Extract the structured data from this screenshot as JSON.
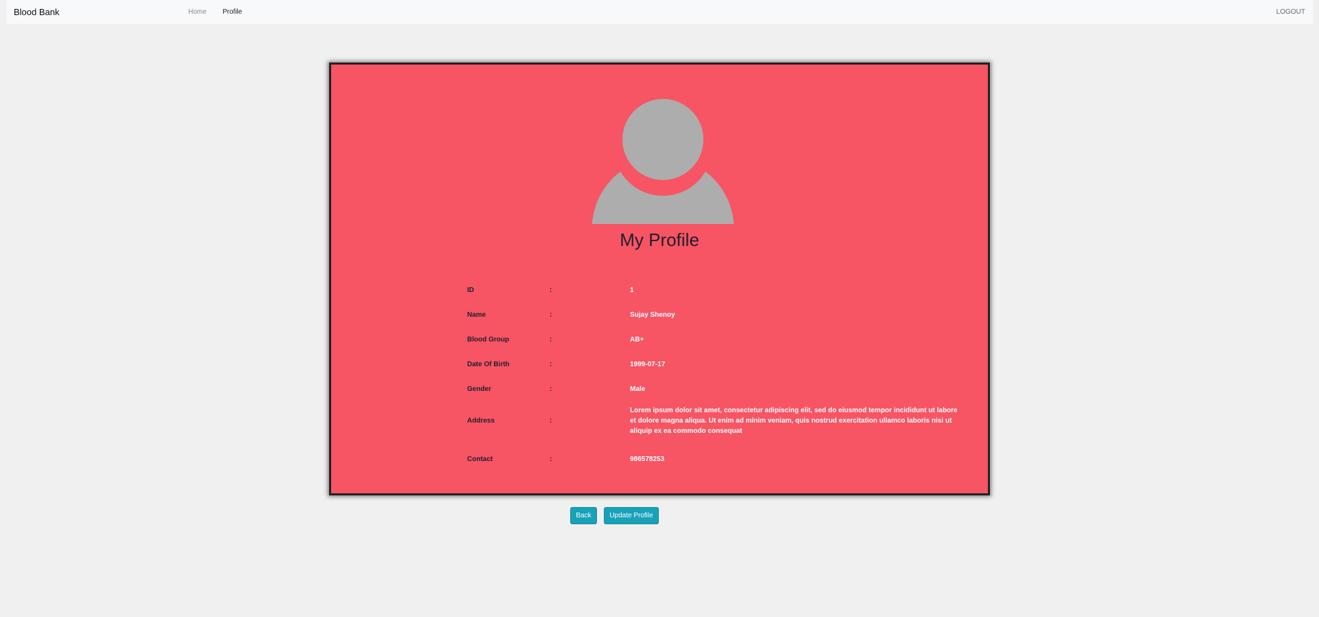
{
  "navbar": {
    "brand": "Blood Bank",
    "links": [
      {
        "label": "Home"
      },
      {
        "label": "Profile"
      }
    ],
    "logout_label": "LOGOUT"
  },
  "profile": {
    "title": "My Profile",
    "avatar_icon": "user-avatar-icon",
    "avatar_color": "#adadad",
    "card_color": "#f75464",
    "fields": [
      {
        "label": "ID",
        "separator": ":",
        "value": "1"
      },
      {
        "label": "Name",
        "separator": ":",
        "value": "Sujay Shenoy"
      },
      {
        "label": "Blood Group",
        "separator": ":",
        "value": "AB+"
      },
      {
        "label": "Date Of Birth",
        "separator": ":",
        "value": "1999-07-17"
      },
      {
        "label": "Gender",
        "separator": ":",
        "value": "Male"
      },
      {
        "label": "Address",
        "separator": ":",
        "value": "Lorem ipsum dolor sit amet, consectetur adipiscing elit, sed do eiusmod tempor incididunt ut labore et dolore magna aliqua. Ut enim ad minim veniam, quis nostrud exercitation ullamco laboris nisi ut aliquip ex ea commodo consequat"
      },
      {
        "label": "Contact",
        "separator": ":",
        "value": "986578253"
      }
    ]
  },
  "actions": {
    "back_label": "Back",
    "update_label": "Update Profile",
    "button_color": "#17a2b8"
  }
}
